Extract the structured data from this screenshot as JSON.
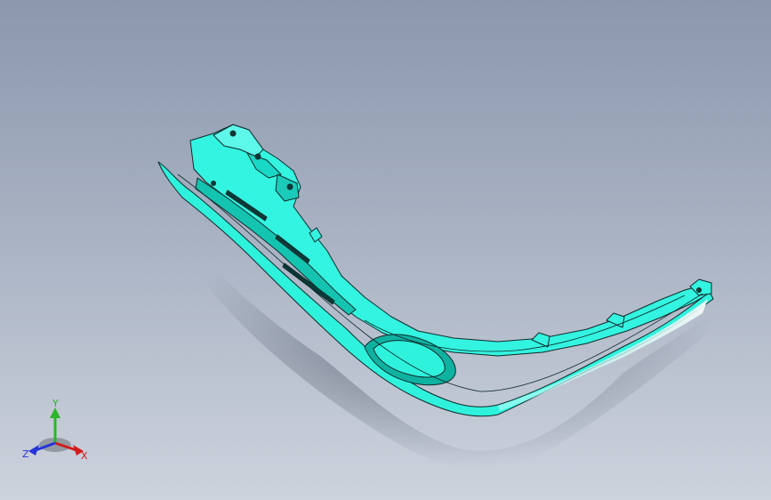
{
  "viewport": {
    "background_top": "#8a97ad",
    "background_bottom": "#cdd3dd",
    "part_color": "#2ff2dd",
    "edge_color": "#0f2a2a"
  },
  "triad": {
    "x_label": "X",
    "y_label": "Y",
    "z_label": "Z",
    "x_color": "#d21c1c",
    "y_color": "#2bb52b",
    "z_color": "#2434d8"
  }
}
